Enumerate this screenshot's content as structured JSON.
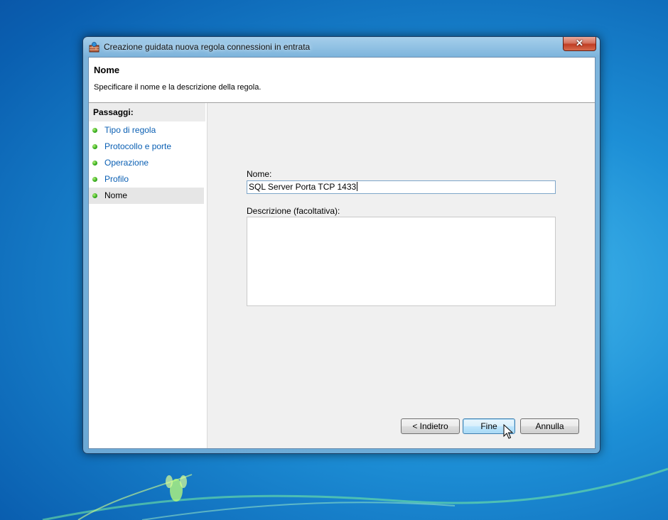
{
  "window": {
    "title": "Creazione guidata nuova regola connessioni in entrata",
    "close_label": "✕"
  },
  "header": {
    "title": "Nome",
    "description": "Specificare il nome e la descrizione della regola."
  },
  "sidebar": {
    "heading": "Passaggi:",
    "steps": [
      {
        "label": "Tipo di regola",
        "status": "completed"
      },
      {
        "label": "Protocollo e porte",
        "status": "completed"
      },
      {
        "label": "Operazione",
        "status": "completed"
      },
      {
        "label": "Profilo",
        "status": "completed"
      },
      {
        "label": "Nome",
        "status": "current"
      }
    ]
  },
  "form": {
    "name_label": "Nome:",
    "name_value": "SQL Server Porta TCP 1433",
    "description_label": "Descrizione (facoltativa):",
    "description_value": ""
  },
  "buttons": {
    "back": "< Indietro",
    "finish": "Fine",
    "cancel": "Annulla"
  },
  "colors": {
    "link": "#0a5fb3",
    "step_dot": "#3ab021",
    "close_button": "#c03c22",
    "desktop": "#1d8fd6"
  }
}
